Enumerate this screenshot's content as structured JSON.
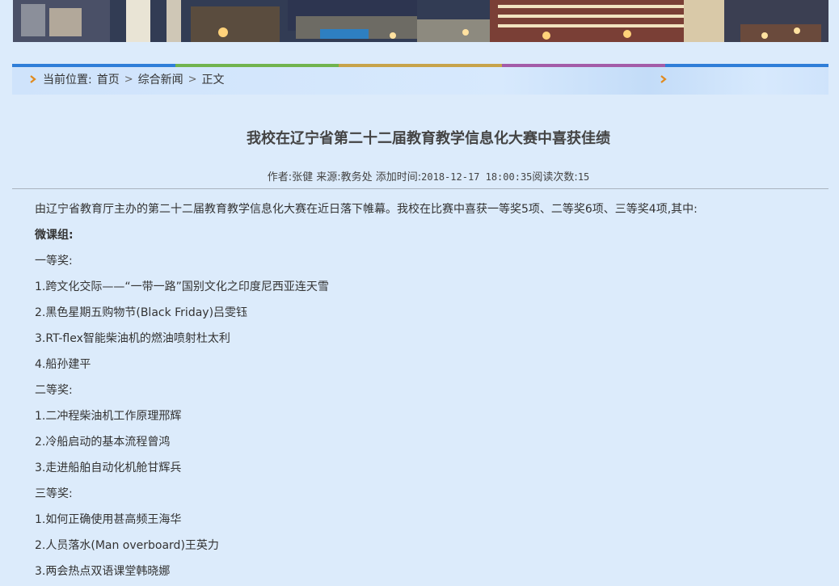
{
  "breadcrumb": {
    "prefix": "当前位置:",
    "items": [
      "首页",
      "综合新闻",
      "正文"
    ],
    "separator": ">"
  },
  "stripe_colors": [
    "#2f7ed8",
    "#71b34e",
    "#c7a34a",
    "#a35ca8",
    "#2f7ed8"
  ],
  "article": {
    "title": "我校在辽宁省第二十二届教育教学信息化大赛中喜获佳绩",
    "meta_author": "作者:张健 来源:教务处 添加时间:",
    "meta_time": "2018-12-17 18:00:35",
    "meta_views_label": "阅读次数:",
    "meta_views": "15",
    "paragraphs": [
      "由辽宁省教育厅主办的第二十二届教育教学信息化大赛在近日落下帷幕。我校在比赛中喜获一等奖5项、二等奖6项、三等奖4项,其中:",
      "微课组:",
      "一等奖:",
      "1.跨文化交际——“一带一路”国别文化之印度尼西亚连天雪",
      "2.黑色星期五购物节(Black Friday)吕雯钰",
      "3.RT-flex智能柴油机的燃油喷射杜太利",
      "4.船孙建平",
      "二等奖:",
      "1.二冲程柴油机工作原理邢辉",
      "2.冷船启动的基本流程曾鸿",
      "3.走进船舶自动化机舱甘辉兵",
      "三等奖:",
      "1.如何正确使用甚高频王海华",
      "2.人员落水(Man overboard)王英力",
      "3.两会热点双语课堂韩晓娜"
    ]
  }
}
